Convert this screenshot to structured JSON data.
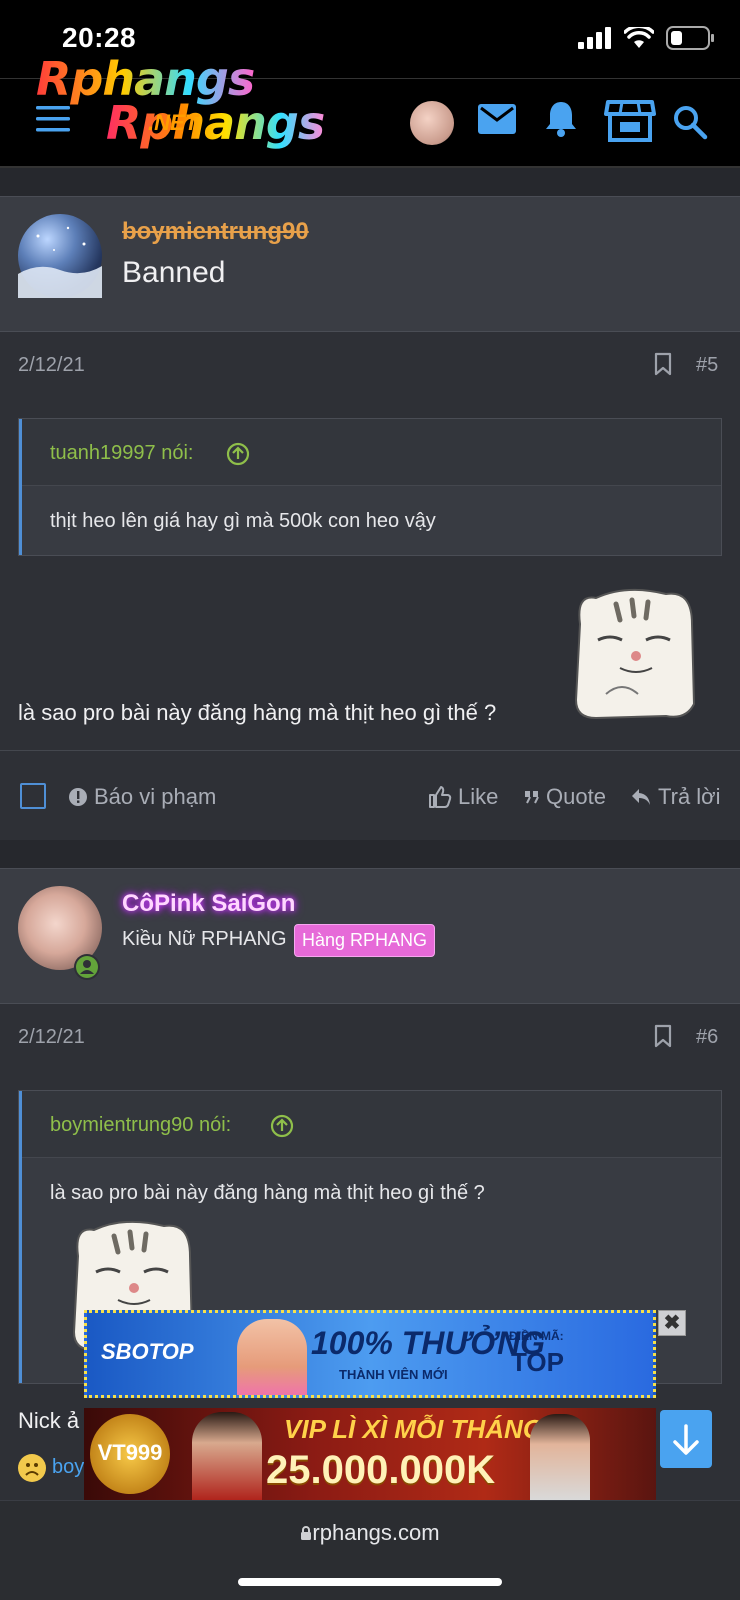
{
  "status_bar": {
    "time": "20:28"
  },
  "header": {
    "logo_line1": "Rphangs",
    "logo_line2": "Rphangs",
    "logo_net": ".NET",
    "icons": [
      "menu-icon",
      "avatar",
      "mail-icon",
      "bell-icon",
      "store-icon",
      "search-icon"
    ]
  },
  "posts": [
    {
      "username": "boymientrung90",
      "user_title": "Banned",
      "date": "2/12/21",
      "post_number": "#5",
      "quote": {
        "author": "tuanh19997 nói:",
        "text": "thịt heo lên giá hay gì mà 500k con heo vậy"
      },
      "message": "là sao pro bài này đăng hàng mà thịt heo gì thế ?",
      "actions": {
        "report": "Báo vi phạm",
        "like": "Like",
        "quote": "Quote",
        "reply": "Trả lời"
      }
    },
    {
      "username": "CôPink SaiGon",
      "user_title": "Kiều Nữ RPHANG",
      "badge": "Hàng RPHANG",
      "date": "2/12/21",
      "post_number": "#6",
      "quote": {
        "author": "boymientrung90 nói:",
        "text": "là sao pro bài này đăng hàng mà thịt heo gì thế ?"
      },
      "message_partial": "Nick ả",
      "reaction_user_partial": "boy"
    }
  ],
  "ads": {
    "ad1_brand": "SBOTOP",
    "ad1_headline": "100% THƯỞNG",
    "ad1_sub": "THÀNH VIÊN MỚI",
    "ad1_code_label": "ĐIỀN MÃ:",
    "ad1_code": "TOP",
    "ad2_brand": "VT999",
    "ad2_headline": "VIP LÌ XÌ MỖI THÁNG",
    "ad2_amount": "25.000.000K",
    "close": "✖"
  },
  "browser": {
    "url": "rphangs.com"
  },
  "colors": {
    "background": "#2e3036",
    "user_band": "#3a3d44",
    "accent_blue": "#4f8fd6",
    "quote_author": "#8fbf4a",
    "banned_name": "#e8a14a",
    "badge_pink": "#e66ad8"
  }
}
